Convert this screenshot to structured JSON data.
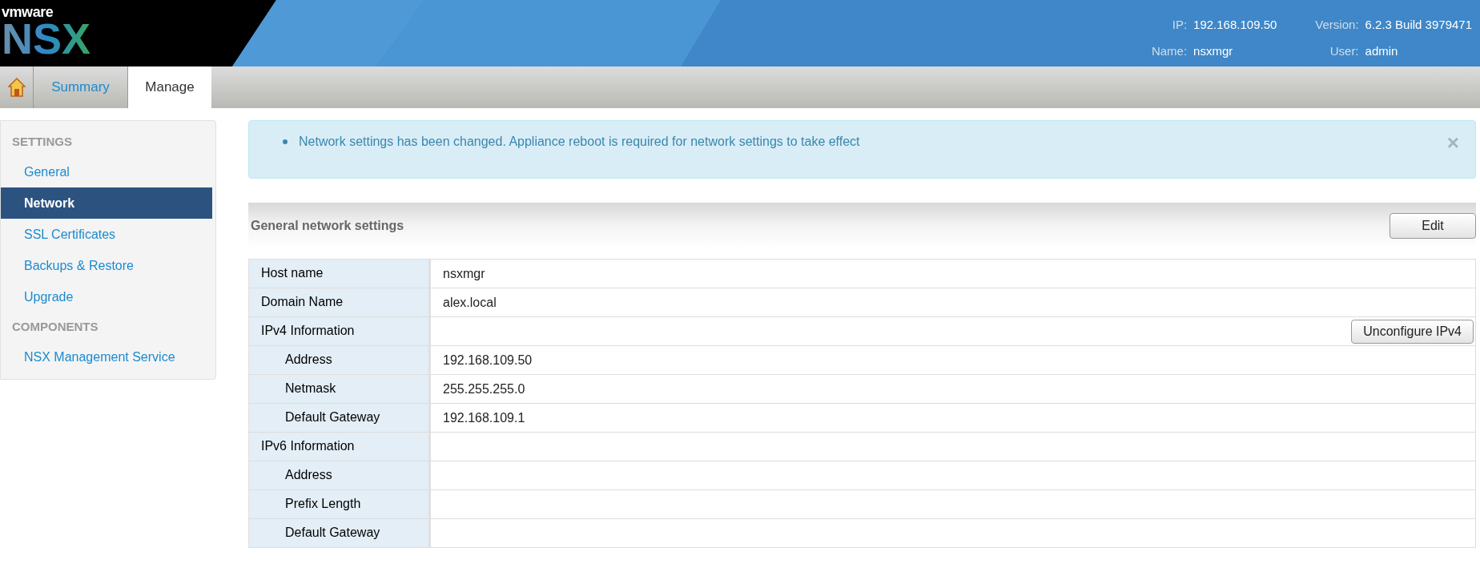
{
  "header": {
    "logo_top": "vmware",
    "logo_main": "NSX",
    "info": [
      {
        "label": "IP:",
        "value": "192.168.109.50"
      },
      {
        "label": "Version:",
        "value": "6.2.3 Build 3979471"
      },
      {
        "label": "Name:",
        "value": "nsxmgr"
      },
      {
        "label": "User:",
        "value": "admin"
      }
    ]
  },
  "tabs": [
    {
      "kind": "home",
      "selected": false
    },
    {
      "kind": "text",
      "label": "Summary",
      "selected": false
    },
    {
      "kind": "text",
      "label": "Manage",
      "selected": true
    }
  ],
  "sidebar": {
    "sections": [
      {
        "title": "SETTINGS",
        "items": [
          {
            "label": "General",
            "selected": false
          },
          {
            "label": "Network",
            "selected": true
          },
          {
            "label": "SSL Certificates",
            "selected": false
          },
          {
            "label": "Backups & Restore",
            "selected": false
          },
          {
            "label": "Upgrade",
            "selected": false
          }
        ]
      },
      {
        "title": "COMPONENTS",
        "items": [
          {
            "label": "NSX Management Service",
            "selected": false
          }
        ]
      }
    ]
  },
  "alert": {
    "messages": [
      "Network settings has been changed. Appliance reboot is required for network settings to take effect"
    ],
    "close": "×"
  },
  "section": {
    "title": "General network settings",
    "button": "Edit"
  },
  "table": {
    "rows": [
      {
        "label": "Host name",
        "value": "nsxmgr"
      },
      {
        "label": "Domain Name",
        "value": "alex.local"
      },
      {
        "label": "IPv4 Information",
        "button": "Unconfigure IPv4",
        "children": [
          {
            "label": "Address",
            "value": "192.168.109.50"
          },
          {
            "label": "Netmask",
            "value": "255.255.255.0"
          },
          {
            "label": "Default Gateway",
            "value": "192.168.109.1"
          }
        ]
      },
      {
        "label": "IPv6 Information",
        "children": [
          {
            "label": "Address"
          },
          {
            "label": "Prefix Length"
          },
          {
            "label": "Default Gateway"
          }
        ]
      }
    ]
  }
}
